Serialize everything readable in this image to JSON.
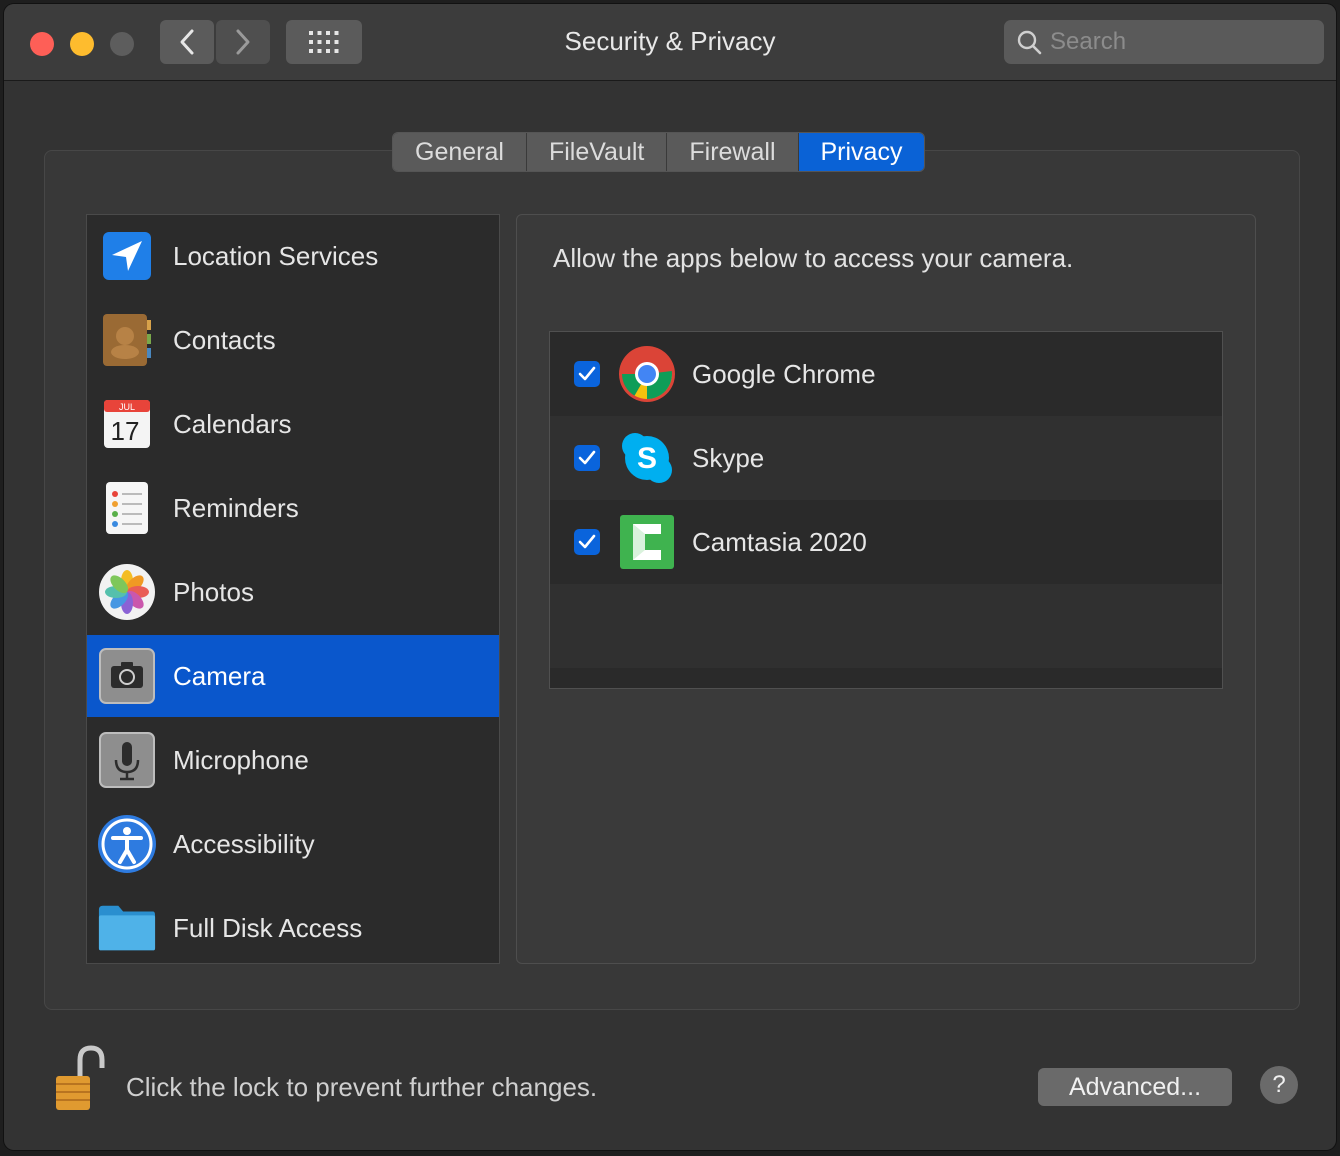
{
  "window": {
    "title": "Security & Privacy",
    "search_placeholder": "Search"
  },
  "tabs": [
    {
      "label": "General",
      "active": false
    },
    {
      "label": "FileVault",
      "active": false
    },
    {
      "label": "Firewall",
      "active": false
    },
    {
      "label": "Privacy",
      "active": true
    }
  ],
  "sidebar": {
    "selected": "Camera",
    "items": [
      {
        "label": "Location Services",
        "icon": "location-arrow-icon"
      },
      {
        "label": "Contacts",
        "icon": "contacts-book-icon"
      },
      {
        "label": "Calendars",
        "icon": "calendar-icon",
        "calendar_month": "JUL",
        "calendar_day": "17"
      },
      {
        "label": "Reminders",
        "icon": "reminders-list-icon"
      },
      {
        "label": "Photos",
        "icon": "photos-flower-icon"
      },
      {
        "label": "Camera",
        "icon": "camera-icon"
      },
      {
        "label": "Microphone",
        "icon": "microphone-icon"
      },
      {
        "label": "Accessibility",
        "icon": "accessibility-icon"
      },
      {
        "label": "Full Disk Access",
        "icon": "folder-icon"
      }
    ]
  },
  "panel": {
    "description": "Allow the apps below to access your camera.",
    "apps": [
      {
        "name": "Google Chrome",
        "checked": true,
        "icon": "chrome-icon"
      },
      {
        "name": "Skype",
        "checked": true,
        "icon": "skype-icon"
      },
      {
        "name": "Camtasia 2020",
        "checked": true,
        "icon": "camtasia-icon"
      }
    ]
  },
  "footer": {
    "lock_text": "Click the lock to prevent further changes.",
    "advanced_label": "Advanced...",
    "help_label": "?"
  },
  "colors": {
    "accent": "#0a62d6",
    "selection": "#0a57cc",
    "close": "#fe5f57",
    "minimize": "#febc2e"
  }
}
